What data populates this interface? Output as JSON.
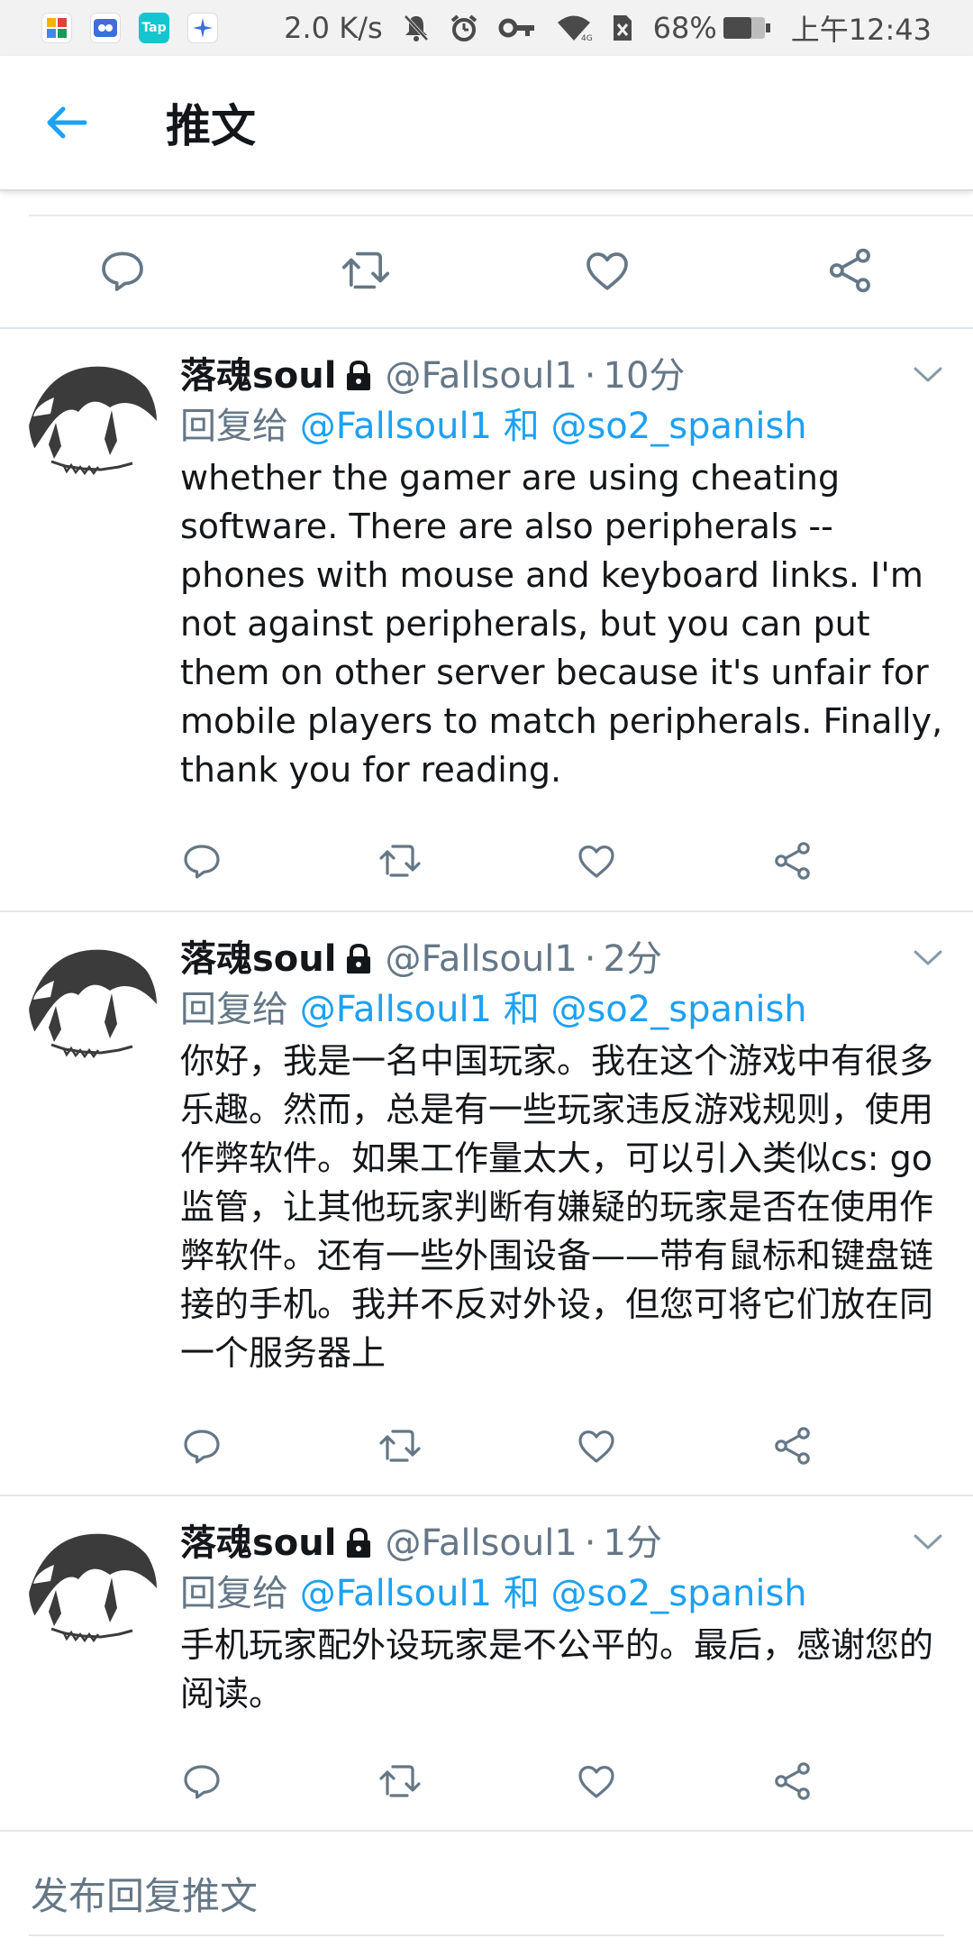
{
  "status_bar": {
    "apps": [
      "Tap"
    ],
    "net_speed": "2.0 K/s",
    "battery": "68%",
    "time": "上午12:43"
  },
  "header": {
    "title": "推文"
  },
  "tweets": [
    {
      "name": "落魂soul",
      "handle": "@Fallsoul1",
      "time": "10分",
      "reply_prefix": "回复给",
      "mention1": "@Fallsoul1",
      "conj": "和",
      "mention2": "@so2_spanish",
      "text": "whether the gamer are using cheating software. There are also peripherals -- phones with mouse and keyboard links. I'm not against peripherals, but you can put them on other server because it's unfair for mobile players to match peripherals. Finally, thank you for reading."
    },
    {
      "name": "落魂soul",
      "handle": "@Fallsoul1",
      "time": "2分",
      "reply_prefix": "回复给",
      "mention1": "@Fallsoul1",
      "conj": "和",
      "mention2": "@so2_spanish",
      "text": "你好，我是一名中国玩家。我在这个游戏中有很多乐趣。然而，总是有一些玩家违反游戏规则，使用作弊软件。如果工作量太大，可以引入类似cs: go监管，让其他玩家判断有嫌疑的玩家是否在使用作弊软件。还有一些外围设备——带有鼠标和键盘链接的手机。我并不反对外设，但您可将它们放在同一个服务器上"
    },
    {
      "name": "落魂soul",
      "handle": "@Fallsoul1",
      "time": "1分",
      "reply_prefix": "回复给",
      "mention1": "@Fallsoul1",
      "conj": "和",
      "mention2": "@so2_spanish",
      "text": "手机玩家配外设玩家是不公平的。最后，感谢您的阅读。"
    }
  ],
  "reply_bar": {
    "placeholder": "发布回复推文"
  },
  "colors": {
    "accent": "#1da1f2",
    "secondary_text": "#657786",
    "icon": "#657786",
    "divider": "#e1e8ed"
  }
}
